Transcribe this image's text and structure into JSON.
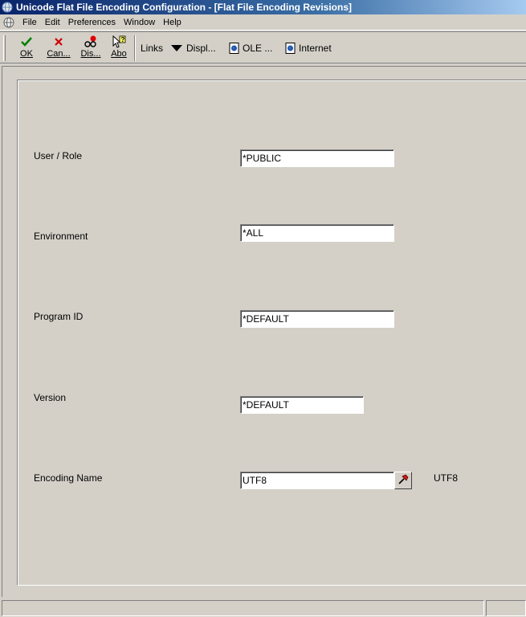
{
  "window": {
    "title": "Unicode Flat File Encoding Configuration - [Flat File Encoding Revisions]"
  },
  "menu": {
    "items": [
      "File",
      "Edit",
      "Preferences",
      "Window",
      "Help"
    ]
  },
  "toolbar": {
    "ok_label": "OK",
    "cancel_label": "Can...",
    "display_label": "Dis...",
    "about_label": "Abo",
    "links_label": "Links",
    "displ_label": "Displ...",
    "ole_label": "OLE ...",
    "internet_label": "Internet"
  },
  "form": {
    "user_role": {
      "label": "User / Role",
      "value": "*PUBLIC"
    },
    "environment": {
      "label": "Environment",
      "value": "*ALL"
    },
    "program_id": {
      "label": "Program ID",
      "value": "*DEFAULT"
    },
    "version": {
      "label": "Version",
      "value": "*DEFAULT"
    },
    "encoding_name": {
      "label": "Encoding Name",
      "value": "UTF8",
      "description": "UTF8"
    }
  },
  "status": {
    "left_text": "",
    "right_text": ""
  },
  "colors": {
    "window_bg": "#d4d0c8",
    "title_bar_start": "#0a246a",
    "title_bar_end": "#a6caf0",
    "ok_icon": "#008000",
    "cancel_icon": "#d00000"
  },
  "icons": {
    "app": "globe-icon",
    "ok": "checkmark-icon",
    "cancel": "x-icon",
    "display": "glasses-icon",
    "about": "pointer-help-icon",
    "links": "dropdown-arrow-icon",
    "ole": "document-globe-icon",
    "internet": "document-globe-icon",
    "lookup": "hammer-icon"
  }
}
